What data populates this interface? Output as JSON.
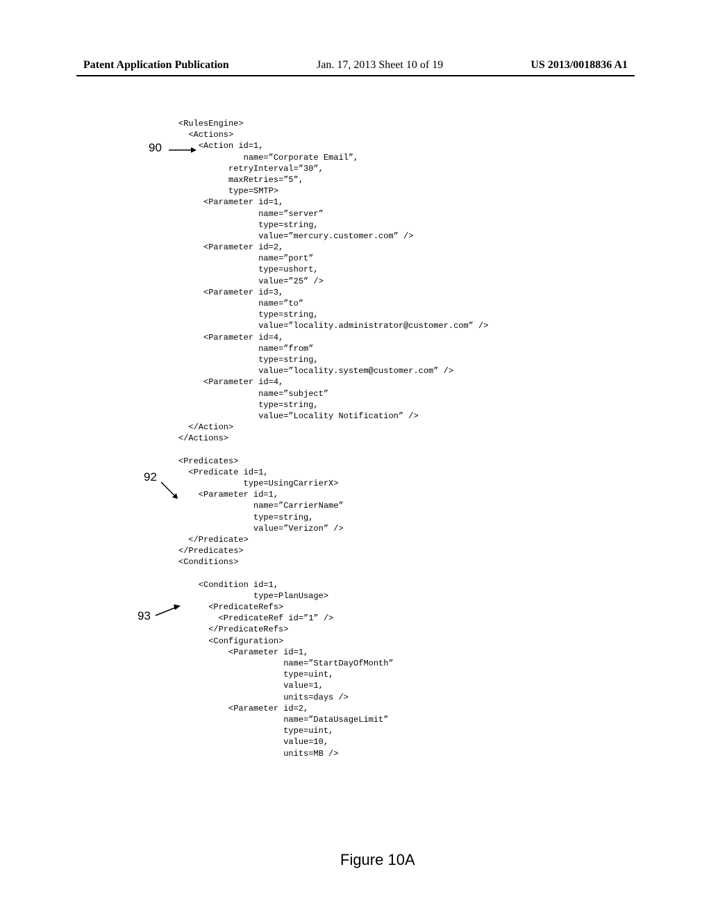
{
  "header": {
    "left": "Patent Application Publication",
    "center": "Jan. 17, 2013  Sheet 10 of 19",
    "right": "US 2013/0018836 A1"
  },
  "annotations": {
    "ref90": "90",
    "ref92": "92",
    "ref93": "93"
  },
  "figure_label": "Figure 10A",
  "code": "<RulesEngine>\n  <Actions>\n    <Action id=1,\n             name=”Corporate Email”,\n          retryInterval=”30”,\n          maxRetries=”5”,\n          type=SMTP>\n     <Parameter id=1,\n                name=”server”\n                type=string,\n                value=”mercury.customer.com” />\n     <Parameter id=2,\n                name=”port”\n                type=ushort,\n                value=”25” />\n     <Parameter id=3,\n                name=”to”\n                type=string,\n                value=”locality.administrator@customer.com” />\n     <Parameter id=4,\n                name=”from”\n                type=string,\n                value=”locality.system@customer.com” />\n     <Parameter id=4,\n                name=”subject”\n                type=string,\n                value=”Locality Notification” />\n  </Action>\n</Actions>\n\n<Predicates>\n  <Predicate id=1,\n             type=UsingCarrierX>\n    <Parameter id=1,\n               name=”CarrierName”\n               type=string,\n               value=”Verizon” />\n  </Predicate>\n</Predicates>\n<Conditions>\n\n    <Condition id=1,\n               type=PlanUsage>\n      <PredicateRefs>\n        <PredicateRef id=”1” />\n      </PredicateRefs>\n      <Configuration>\n          <Parameter id=1,\n                     name=”StartDayOfMonth”\n                     type=uint,\n                     value=1,\n                     units=days />\n          <Parameter id=2,\n                     name=”DataUsageLimit”\n                     type=uint,\n                     value=10,\n                     units=MB />"
}
